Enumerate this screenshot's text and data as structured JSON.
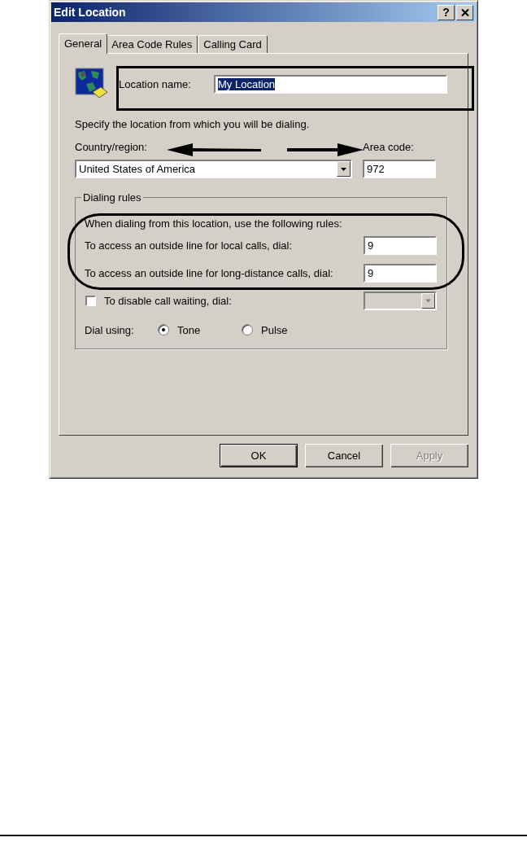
{
  "window": {
    "title": "Edit Location",
    "help_button": "?"
  },
  "tabs": [
    {
      "label": "General",
      "selected": true
    },
    {
      "label": "Area Code Rules",
      "selected": false
    },
    {
      "label": "Calling Card",
      "selected": false
    }
  ],
  "location_name": {
    "label": "Location name:",
    "value": "My Location",
    "selected_text": true
  },
  "instruction": "Specify the location from which you will be dialing.",
  "country": {
    "label": "Country/region:",
    "value": "United States of America"
  },
  "area_code": {
    "label": "Area code:",
    "value": "972"
  },
  "dialing_rules": {
    "title": "Dialing rules",
    "intro": "When dialing from this location, use the following rules:",
    "rules": [
      {
        "label": "To access an outside line for local calls, dial:",
        "value": "9"
      },
      {
        "label": "To access an outside line for long-distance calls, dial:",
        "value": "9"
      }
    ],
    "call_waiting": {
      "label": "To disable call waiting, dial:",
      "checked": false,
      "disabled": true
    },
    "dial_using": {
      "label": "Dial using:",
      "options": [
        {
          "label": "Tone",
          "selected": true
        },
        {
          "label": "Pulse",
          "selected": false
        }
      ]
    }
  },
  "buttons": [
    {
      "label": "OK",
      "default": true,
      "disabled": false
    },
    {
      "label": "Cancel",
      "default": false,
      "disabled": false
    },
    {
      "label": "Apply",
      "default": false,
      "disabled": true
    }
  ]
}
